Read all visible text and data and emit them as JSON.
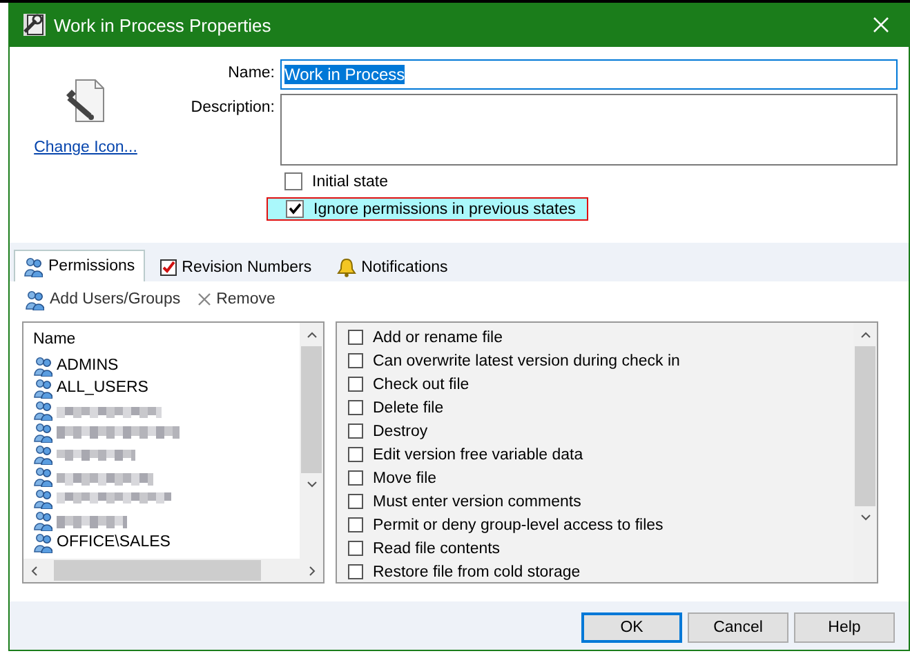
{
  "window": {
    "title": "Work in Process Properties"
  },
  "change_icon_link": "Change Icon...",
  "fields": [
    {
      "kind": "line",
      "label": "Name:",
      "value": "Work in Process",
      "selected": true
    },
    {
      "kind": "multiline",
      "label": "Description:"
    }
  ],
  "options": [
    {
      "label": "Initial state",
      "checked": false,
      "highlighted": false
    },
    {
      "label": "Ignore permissions in previous states",
      "checked": true,
      "highlighted": true
    }
  ],
  "tabs": [
    {
      "label": "Permissions",
      "selected": true
    },
    {
      "label": "Revision Numbers",
      "selected": false
    },
    {
      "label": "Notifications",
      "selected": false
    }
  ],
  "toolbar": [
    {
      "label": "Add Users/Groups"
    },
    {
      "label": "Remove"
    }
  ],
  "users": {
    "column": "Name",
    "items": [
      {
        "kind": "name",
        "label": "ADMINS"
      },
      {
        "kind": "name",
        "label": "ALL_USERS"
      },
      {
        "kind": "blurred"
      },
      {
        "kind": "blurred"
      },
      {
        "kind": "blurred"
      },
      {
        "kind": "blurred"
      },
      {
        "kind": "blurred"
      },
      {
        "kind": "blurred"
      },
      {
        "kind": "name",
        "label": "OFFICE\\SALES"
      }
    ]
  },
  "permissions": [
    {
      "label": "Add or rename file",
      "checked": false
    },
    {
      "label": "Can overwrite latest version during check in",
      "checked": false
    },
    {
      "label": "Check out file",
      "checked": false
    },
    {
      "label": "Delete file",
      "checked": false
    },
    {
      "label": "Destroy",
      "checked": false
    },
    {
      "label": "Edit version free variable data",
      "checked": false
    },
    {
      "label": "Move file",
      "checked": false
    },
    {
      "label": "Must enter version comments",
      "checked": false
    },
    {
      "label": "Permit or deny group-level access to files",
      "checked": false
    },
    {
      "label": "Read file contents",
      "checked": false
    },
    {
      "label": "Restore file from cold storage",
      "checked": false
    }
  ],
  "buttons": [
    {
      "label": "OK",
      "default": true
    },
    {
      "label": "Cancel",
      "default": false
    },
    {
      "label": "Help",
      "default": false
    }
  ]
}
